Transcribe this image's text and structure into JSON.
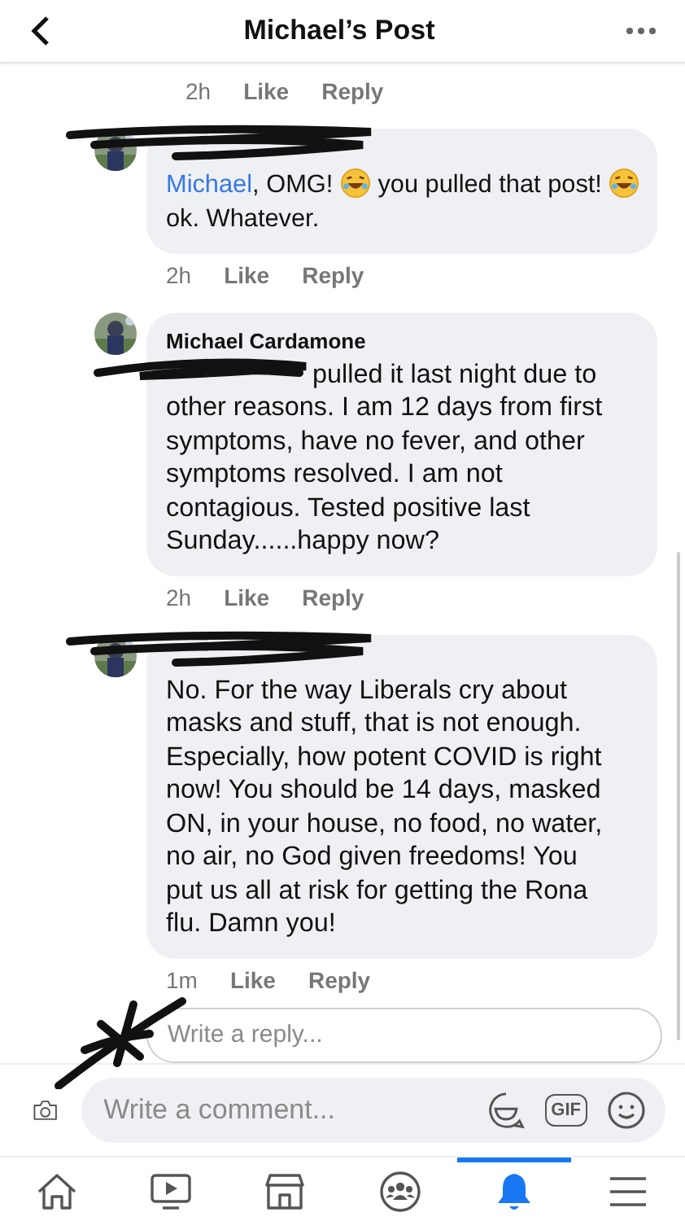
{
  "header": {
    "title": "Michael’s Post"
  },
  "top_actions": {
    "time": "2h",
    "like": "Like",
    "reply": "Reply"
  },
  "comments": [
    {
      "redacted": true,
      "segments": [
        {
          "kind": "mention",
          "text": "Michael"
        },
        {
          "kind": "text",
          "text": ", OMG! "
        },
        {
          "kind": "emoji"
        },
        {
          "kind": "text",
          "text": " you pulled that post! "
        },
        {
          "kind": "emoji"
        },
        {
          "kind": "text",
          "text": " ok.  Whatever."
        }
      ],
      "time": "2h",
      "like": "Like",
      "reply": "Reply"
    },
    {
      "redacted": false,
      "author": "Michael Cardamone",
      "mention_redacted": true,
      "segments": [
        {
          "kind": "text",
          "text": "pulled it last night due to other reasons. I am 12 days from first symptoms, have no fever,  and other symptoms resolved. I am not contagious. Tested positive last Sunday......happy now?"
        }
      ],
      "time": "2h",
      "like": "Like",
      "reply": "Reply"
    },
    {
      "redacted": true,
      "segments": [
        {
          "kind": "text",
          "text": "No. For the way Liberals cry about masks and stuff, that is not enough. Especially, how potent COVID is right now!  You should be 14 days, masked ON, in your house, no food, no water, no air, no God given freedoms!  You put us all at risk for getting the Rona flu. Damn you!"
        }
      ],
      "time": "1m",
      "like": "Like",
      "reply": "Reply"
    }
  ],
  "reply_field": {
    "placeholder": "Write a reply..."
  },
  "comment_bar": {
    "placeholder": "Write a comment...",
    "gif": "GIF"
  },
  "tabs": [
    {
      "kind": "home",
      "selected": false
    },
    {
      "kind": "video",
      "selected": false
    },
    {
      "kind": "marketplace",
      "selected": false
    },
    {
      "kind": "groups",
      "selected": false
    },
    {
      "kind": "notifications",
      "selected": true
    },
    {
      "kind": "menu",
      "selected": false
    }
  ]
}
